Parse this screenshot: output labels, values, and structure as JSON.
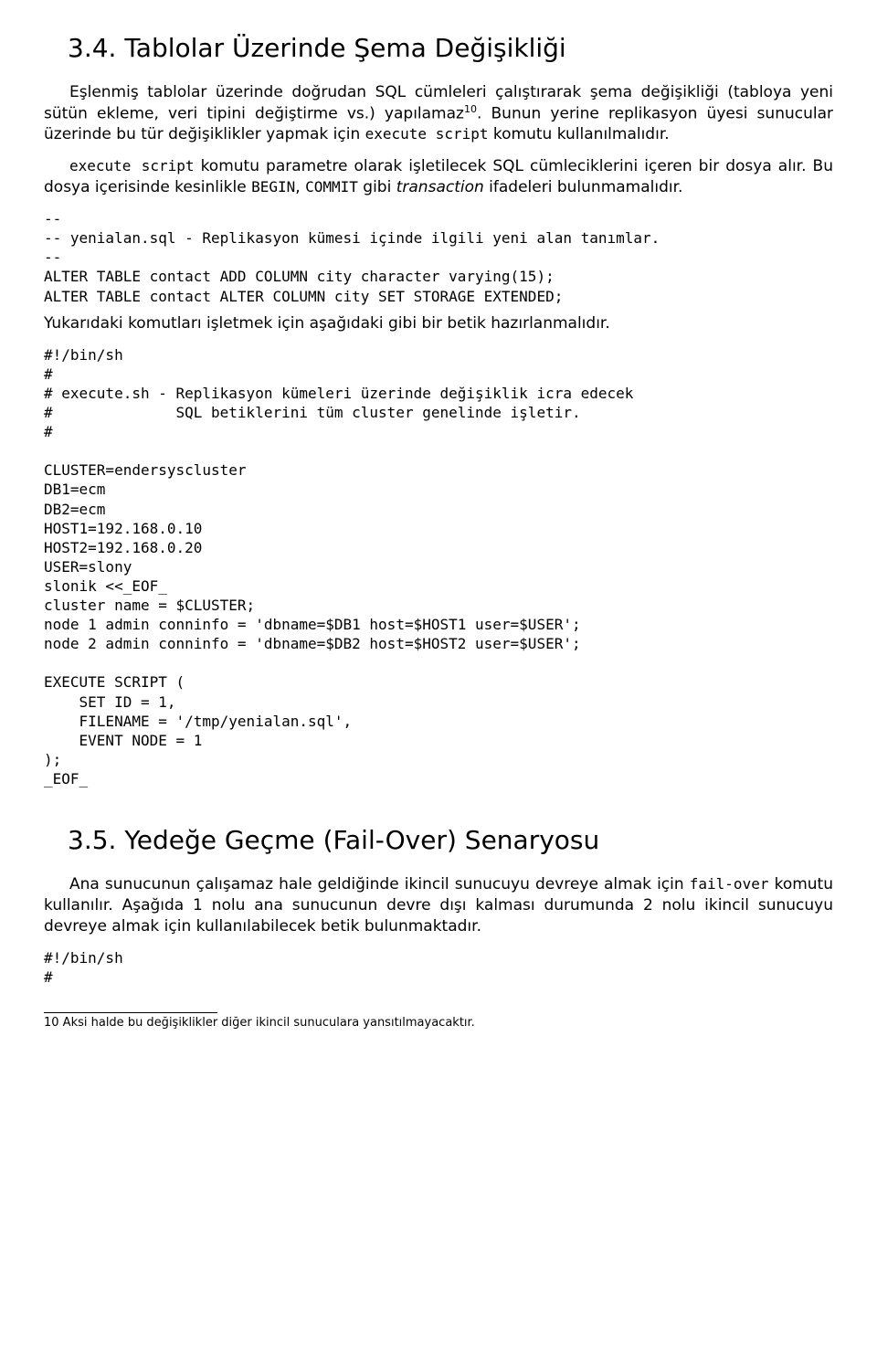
{
  "heading1": "3.4. Tablolar Üzerinde Şema Değişikliği",
  "para1_a": "Eşlenmiş tablolar üzerinde doğrudan SQL cümleleri çalıştırarak şema değişikliği (tabloya yeni sütün ekleme, veri tipini değiştirme vs.) yapılamaz",
  "para1_sup": "10",
  "para1_b": ". Bunun yerine replikasyon üyesi sunucular üzerinde bu tür değişiklikler yapmak için ",
  "para1_code1": "execute script",
  "para1_c": " komutu kullanılmalıdır.",
  "para2_pre": "execute script",
  "para2_a": " komutu parametre olarak işletilecek SQL cümleciklerini içeren bir dosya alır. Bu dosya içerisinde kesinlikle ",
  "para2_code_begin": "BEGIN",
  "para2_mid": ", ",
  "para2_code_commit": "COMMIT",
  "para2_b": " gibi ",
  "para2_italic": "transaction",
  "para2_c": " ifadeleri bulunmamalıdır.",
  "code_block1": "--\n-- yenialan.sql - Replikasyon kümesi içinde ilgili yeni alan tanımlar.\n--\nALTER TABLE contact ADD COLUMN city character varying(15);\nALTER TABLE contact ALTER COLUMN city SET STORAGE EXTENDED;",
  "para3": "Yukarıdaki komutları işletmek için aşağıdaki gibi bir betik hazırlanmalıdır.",
  "code_block2": "#!/bin/sh\n#\n# execute.sh - Replikasyon kümeleri üzerinde değişiklik icra edecek\n#              SQL betiklerini tüm cluster genelinde işletir.\n#\n\nCLUSTER=endersyscluster\nDB1=ecm\nDB2=ecm\nHOST1=192.168.0.10\nHOST2=192.168.0.20\nUSER=slony\nslonik <<_EOF_\ncluster name = $CLUSTER;\nnode 1 admin conninfo = 'dbname=$DB1 host=$HOST1 user=$USER';\nnode 2 admin conninfo = 'dbname=$DB2 host=$HOST2 user=$USER';\n\nEXECUTE SCRIPT (\n    SET ID = 1,\n    FILENAME = '/tmp/yenialan.sql',\n    EVENT NODE = 1\n);\n_EOF_",
  "heading2": "3.5. Yedeğe Geçme (Fail-Over) Senaryosu",
  "para4_a": "Ana sunucunun çalışamaz hale geldiğinde ikincil sunucuyu devreye almak için ",
  "para4_code": "fail-over",
  "para4_b": " komutu kullanılır. Aşağıda 1 nolu ana sunucunun devre dışı kalması durumunda 2 nolu ikincil sunucuyu devreye almak için kullanılabilecek betik bulunmaktadır.",
  "code_block3": "#!/bin/sh\n#",
  "footnote": "10 Aksi halde bu değişiklikler diğer ikincil sunuculara yansıtılmayacaktır."
}
